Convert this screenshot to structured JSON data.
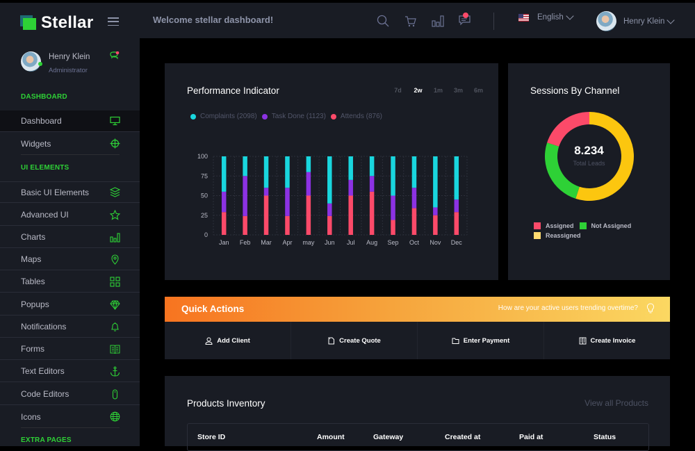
{
  "brand": {
    "name": "Stellar"
  },
  "profile": {
    "name": "Henry Klein",
    "role": "Administrator"
  },
  "sidebar": {
    "sections": [
      {
        "title": "DASHBOARD"
      },
      {
        "title": "UI ELEMENTS"
      },
      {
        "title": "EXTRA PAGES"
      }
    ],
    "items": [
      {
        "label": "Dashboard",
        "icon": "monitor-icon",
        "active": true
      },
      {
        "label": "Widgets",
        "icon": "crosshair-icon"
      },
      {
        "label": "Basic UI Elements",
        "icon": "layers-icon"
      },
      {
        "label": "Advanced UI",
        "icon": "star-icon"
      },
      {
        "label": "Charts",
        "icon": "bar-chart-icon"
      },
      {
        "label": "Maps",
        "icon": "map-pin-icon"
      },
      {
        "label": "Tables",
        "icon": "grid-icon"
      },
      {
        "label": "Popups",
        "icon": "diamond-icon"
      },
      {
        "label": "Notifications",
        "icon": "bell-icon"
      },
      {
        "label": "Forms",
        "icon": "book-icon"
      },
      {
        "label": "Text Editors",
        "icon": "anchor-icon"
      },
      {
        "label": "Code Editors",
        "icon": "mouse-icon"
      },
      {
        "label": "Icons",
        "icon": "globe-icon"
      }
    ]
  },
  "header": {
    "welcome": "Welcome stellar dashboard!",
    "icons": [
      "search-icon",
      "cart-icon",
      "bar-chart-icon",
      "message-icon"
    ],
    "language": "English",
    "user": "Henry Klein"
  },
  "performance": {
    "title": "Performance Indicator",
    "ranges": [
      {
        "label": "7d"
      },
      {
        "label": "2w",
        "active": true
      },
      {
        "label": "1m"
      },
      {
        "label": "3m"
      },
      {
        "label": "6m"
      }
    ],
    "legend": [
      {
        "label": "Complaints (2098)",
        "color": "#19d6de"
      },
      {
        "label": "Task Done (1123)",
        "color": "#8c32e3"
      },
      {
        "label": "Attends (876)",
        "color": "#fc4a69"
      }
    ]
  },
  "sessions": {
    "title": "Sessions By Channel",
    "total": "8.234",
    "total_label": "Total Leads",
    "legend": [
      {
        "label": "Assigned",
        "color": "#fc4a69"
      },
      {
        "label": "Not Assigned",
        "color": "#2ed136"
      },
      {
        "label": "Reassigned",
        "color": "#ffdb70"
      }
    ]
  },
  "quick_actions": {
    "title": "Quick Actions",
    "question": "How are your active users trending overtime?",
    "buttons": [
      {
        "label": "Add Client",
        "icon": "user-icon"
      },
      {
        "label": "Create Quote",
        "icon": "file-icon"
      },
      {
        "label": "Enter Payment",
        "icon": "folder-icon"
      },
      {
        "label": "Create Invoice",
        "icon": "invoice-icon"
      }
    ]
  },
  "products": {
    "title": "Products Inventory",
    "view_all": "View all Products",
    "columns": [
      "Store ID",
      "Amount",
      "Gateway",
      "Created at",
      "Paid at",
      "Status"
    ]
  },
  "chart_data": [
    {
      "type": "bar",
      "stacked": true,
      "title": "Performance Indicator",
      "categories": [
        "Jan",
        "Feb",
        "Mar",
        "Apr",
        "may",
        "Jun",
        "Jul",
        "Aug",
        "Sep",
        "Oct",
        "Nov",
        "Dec"
      ],
      "series": [
        {
          "name": "Attends",
          "color": "#fc4a69",
          "values": [
            29,
            24,
            50,
            24,
            50,
            24,
            50,
            55,
            19,
            34,
            25,
            29
          ]
        },
        {
          "name": "Task Done",
          "color": "#8c32e3",
          "values": [
            26,
            51,
            10,
            36,
            30,
            16,
            20,
            20,
            31,
            26,
            10,
            16
          ]
        },
        {
          "name": "Complaints",
          "color": "#19d6de",
          "values": [
            45,
            25,
            40,
            40,
            20,
            60,
            30,
            25,
            50,
            40,
            65,
            55
          ]
        }
      ],
      "yticks": [
        0,
        25,
        50,
        75,
        100
      ],
      "ylim": [
        0,
        100
      ],
      "xlabel": "",
      "ylabel": "",
      "grid": true
    },
    {
      "type": "pie",
      "donut": true,
      "title": "Sessions By Channel",
      "center_value": "8.234",
      "center_label": "Total Leads",
      "slices": [
        {
          "name": "Reassigned",
          "color": "#fcc60f",
          "value": 55
        },
        {
          "name": "Not Assigned",
          "color": "#2ed136",
          "value": 25
        },
        {
          "name": "Assigned",
          "color": "#fc4a69",
          "value": 20
        }
      ],
      "legend": "bottom"
    }
  ]
}
